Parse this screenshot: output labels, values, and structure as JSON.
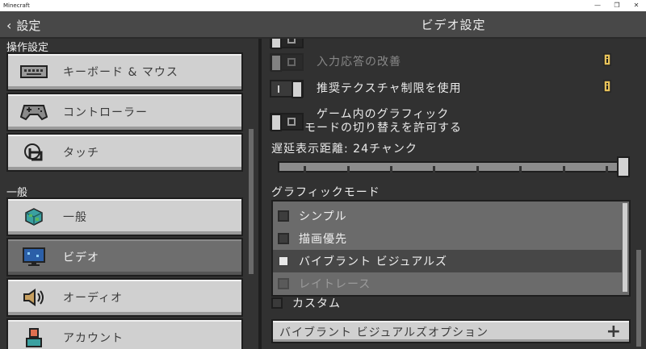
{
  "window": {
    "title": "Minecraft",
    "controls": [
      "—",
      "❐",
      "✕"
    ]
  },
  "header": {
    "back_label": "設定",
    "title": "ビデオ設定"
  },
  "left": {
    "section_controls": "操作設定",
    "section_general": "一般",
    "items": [
      {
        "label": "キーボード & マウス",
        "icon": "keyboard-icon",
        "active": false
      },
      {
        "label": "コントローラー",
        "icon": "controller-icon",
        "active": false
      },
      {
        "label": "タッチ",
        "icon": "touch-icon",
        "active": false
      },
      {
        "label": "一般",
        "icon": "globe-cube-icon",
        "active": false
      },
      {
        "label": "ビデオ",
        "icon": "monitor-icon",
        "active": true
      },
      {
        "label": "オーディオ",
        "icon": "speaker-icon",
        "active": false
      },
      {
        "label": "アカウント",
        "icon": "account-icon",
        "active": false
      }
    ]
  },
  "video": {
    "input_delay": {
      "label": "入力応答の改善",
      "on": false,
      "enabled": false
    },
    "texture_limit": {
      "label": "推奨テクスチャ制限を使用",
      "on": true
    },
    "graphics_mode_switch": {
      "line1": "ゲーム内のグラフィック",
      "line2": "モードの切り替えを許可する",
      "on": false
    },
    "render_distance": {
      "label": "遅延表示距離: 24チャンク",
      "value": 24,
      "max": 24
    },
    "graphics_mode": {
      "label": "グラフィックモード",
      "options": [
        {
          "label": "シンプル",
          "selected": false,
          "enabled": true
        },
        {
          "label": "描画優先",
          "selected": false,
          "enabled": true
        },
        {
          "label": "バイブラント ビジュアルズ",
          "selected": true,
          "enabled": true
        },
        {
          "label": "レイトレース",
          "selected": false,
          "enabled": false
        }
      ],
      "custom_label": "カスタム"
    },
    "vibrant_options_button": {
      "label": "バイブラント ビジュアルズオプション",
      "icon": "plus-icon"
    }
  },
  "colors": {
    "panel": "#313131",
    "button": "#d0d0d0",
    "active_button": "#6e6e6e",
    "info": "#e8c35a"
  }
}
